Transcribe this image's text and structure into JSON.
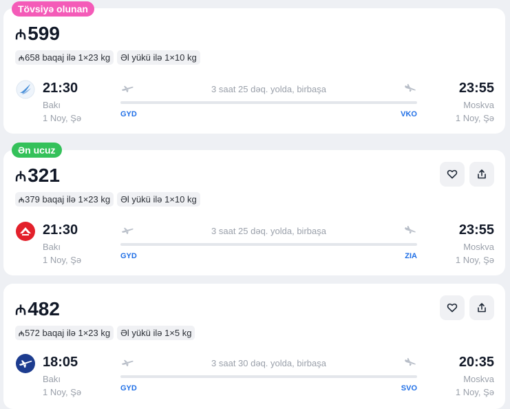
{
  "currency_symbol": "₼",
  "colors": {
    "recommended_badge": "#f45bb8",
    "cheapest_badge": "#34c15a",
    "route_code": "#1e6ee6",
    "muted_text": "#9aa0aa"
  },
  "offers": [
    {
      "badge": "Tövsiyə olunan",
      "price": "599",
      "baggage_price": "658",
      "baggage_text": "baqaj ilə 1×23 kg",
      "hand_luggage": "Əl yükü ilə 1×10 kg",
      "airline_logo": "swallow-logo",
      "dep_time": "21:30",
      "dep_city": "Bakı",
      "dep_date": "1 Noy, Şə",
      "duration": "3 saat 25 dəq. yolda, birbaşa",
      "dep_code": "GYD",
      "arr_code": "VKO",
      "arr_time": "23:55",
      "arr_city": "Moskva",
      "arr_date": "1 Noy, Şə"
    },
    {
      "badge": "Ən ucuz",
      "price": "321",
      "baggage_price": "379",
      "baggage_text": "baqaj ilə 1×23 kg",
      "hand_luggage": "Əl yükü ilə 1×10 kg",
      "airline_logo": "red-wings-logo",
      "dep_time": "21:30",
      "dep_city": "Bakı",
      "dep_date": "1 Noy, Şə",
      "duration": "3 saat 25 dəq. yolda, birbaşa",
      "dep_code": "GYD",
      "arr_code": "ZIA",
      "arr_time": "23:55",
      "arr_city": "Moskva",
      "arr_date": "1 Noy, Şə"
    },
    {
      "price": "482",
      "baggage_price": "572",
      "baggage_text": "baqaj ilə 1×23 kg",
      "hand_luggage": "Əl yükü ilə 1×5 kg",
      "airline_logo": "blue-plane-logo",
      "dep_time": "18:05",
      "dep_city": "Bakı",
      "dep_date": "1 Noy, Şə",
      "duration": "3 saat 30 dəq. yolda, birbaşa",
      "dep_code": "GYD",
      "arr_code": "SVO",
      "arr_time": "20:35",
      "arr_city": "Moskva",
      "arr_date": "1 Noy, Şə"
    }
  ]
}
